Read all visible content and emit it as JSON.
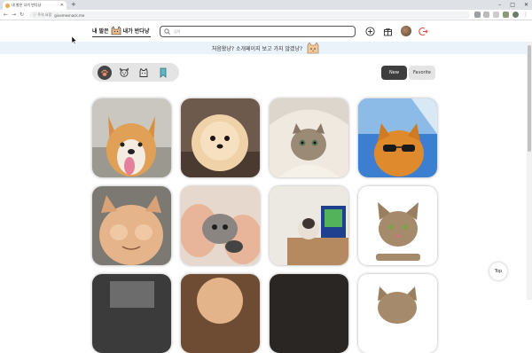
{
  "browser": {
    "tab_title": "내 발은 너가 반다냥",
    "new_tab": "+",
    "address_security": "ⓘ 주의 요함",
    "address_url": "givemesnack.me",
    "window_controls": [
      "–",
      "□",
      "✕"
    ]
  },
  "header": {
    "logo_text_left": "내 발은",
    "logo_text_right": "내가 반다냥",
    "search_placeholder": "검색"
  },
  "banner": {
    "text": "처음왔냥? 소개페이지 보고 가지 않겠냥?"
  },
  "filters": {
    "items": [
      {
        "id": "all",
        "icon": "paw-icon",
        "active": true
      },
      {
        "id": "dog",
        "icon": "dog-face-icon",
        "active": false
      },
      {
        "id": "cat",
        "icon": "cat-face-icon",
        "active": false
      },
      {
        "id": "bookmark",
        "icon": "bookmark-icon",
        "active": false
      }
    ]
  },
  "sort": {
    "new_label": "New",
    "favorite_label": "Favorite"
  },
  "posts": [
    {
      "subject": "corgi tongue out"
    },
    {
      "subject": "fluffy pomeranian"
    },
    {
      "subject": "kitten in blanket"
    },
    {
      "subject": "orange cat sunglasses"
    },
    {
      "subject": "cat paws on face"
    },
    {
      "subject": "kitten held in hands"
    },
    {
      "subject": "cat on shelf by monitor"
    },
    {
      "subject": "tabby cat on white"
    },
    {
      "subject": "dark cat photo"
    },
    {
      "subject": "pomeranian"
    },
    {
      "subject": "dark photo"
    },
    {
      "subject": "tabby cat"
    }
  ],
  "top_button_label": "Top",
  "colors": {
    "banner_bg": "#eaf3fa",
    "active_sort": "#3e3e3e",
    "filter_bg": "#e4e4e4"
  }
}
